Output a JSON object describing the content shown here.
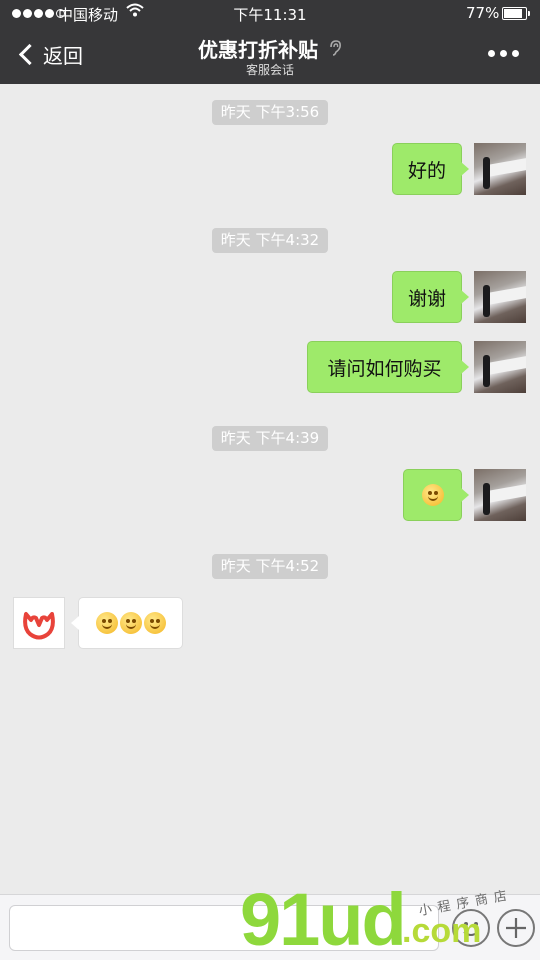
{
  "status_bar": {
    "carrier": "中国移动",
    "time": "下午11:31",
    "battery": "77%",
    "battery_level": 0.77,
    "wifi_icon": "wifi-icon"
  },
  "nav": {
    "back_label": "返回",
    "title": "优惠打折补贴",
    "subtitle": "客服会话",
    "ear_icon": "ear-icon",
    "more_icon": "more-icon"
  },
  "timestamps": [
    "昨天 下午3:56",
    "昨天 下午4:32",
    "昨天 下午4:39",
    "昨天 下午4:52"
  ],
  "messages": [
    {
      "from": "me",
      "text": "好的"
    },
    {
      "from": "me",
      "text": "谢谢"
    },
    {
      "from": "me",
      "text": "请问如何购买"
    },
    {
      "from": "me",
      "emoji": "smile-emoji"
    },
    {
      "from": "shop",
      "emoji": [
        "smirk-emoji",
        "smirk-emoji",
        "grin-emoji"
      ]
    }
  ],
  "input_bar": {
    "emoji_button_icon": "emoji-icon",
    "add_button_icon": "plus-icon"
  },
  "watermark": {
    "main": "91ud",
    "com": ".com",
    "sub": "小程序商店"
  },
  "colors": {
    "nav_bg": "#373739",
    "chat_bg": "#ebebeb",
    "my_bubble": "#9eea6a",
    "their_bubble": "#ffffff",
    "timestamp_bg": "#cecece",
    "shop_logo": "#e8433a"
  }
}
